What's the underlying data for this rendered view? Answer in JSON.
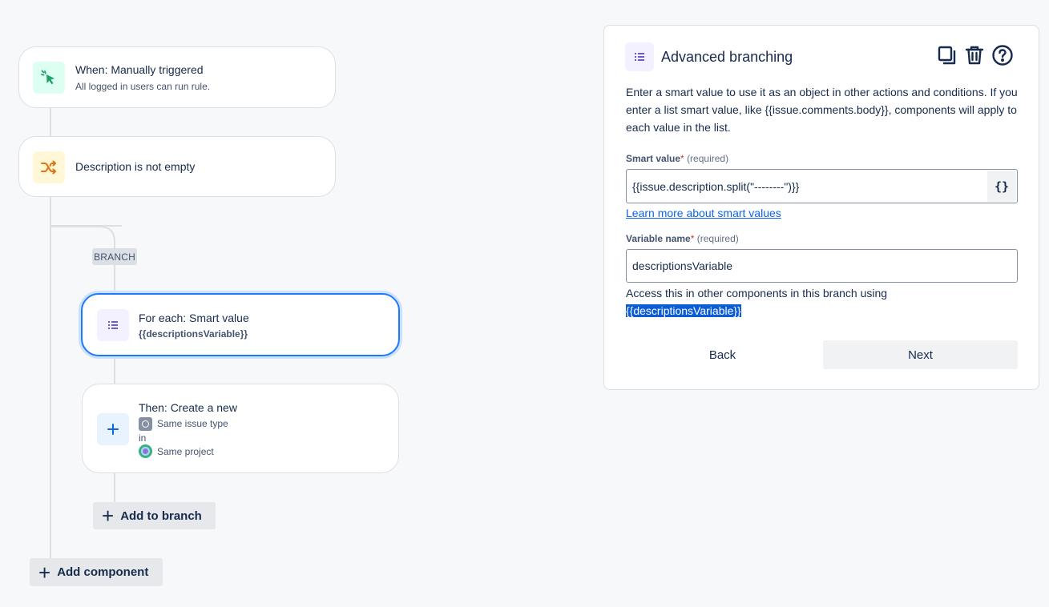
{
  "flow": {
    "trigger": {
      "title": "When: Manually triggered",
      "subtitle": "All logged in users can run rule."
    },
    "condition": {
      "title": "Description is not empty"
    },
    "branch_tag": "BRANCH",
    "foreach": {
      "title": "For each: Smart value",
      "subtitle": "{{descriptionsVariable}}"
    },
    "action": {
      "title": "Then: Create a new",
      "line1": "Same issue type",
      "line2": "in",
      "line3": "Same project"
    },
    "add_to_branch": "Add to branch",
    "add_component": "Add component"
  },
  "panel": {
    "title": "Advanced branching",
    "description": "Enter a smart value to use it as an object in other actions and conditions. If you enter a list smart value, like {{issue.comments.body}}, components will apply to each value in the list.",
    "smart_value_label": "Smart value",
    "required_star": "*",
    "required_text": "(required)",
    "smart_value": "{{issue.description.split(\"--------\")}}",
    "braces": "{}",
    "learn_more": "Learn more about smart values",
    "variable_label": "Variable name",
    "variable_value": "descriptionsVariable",
    "hint_text": "Access this in other components in this branch using",
    "hint_token": "{{descriptionsVariable}}",
    "back": "Back",
    "next": "Next"
  },
  "icons": {
    "trigger": "cursor-click-icon",
    "condition": "shuffle-icon",
    "foreach": "list-icon",
    "action": "plus-icon",
    "duplicate": "copy-icon",
    "delete": "trash-icon",
    "help": "help-icon"
  },
  "colors": {
    "accent": "#0c66e4",
    "selected_border": "#1d7afc",
    "trigger_bg": "#dcfff1",
    "trigger_icon": "#22a06b",
    "condition_bg": "#fff7d6",
    "condition_icon": "#e2740f",
    "list_bg": "#f3f0ff",
    "list_icon": "#6e5dc6",
    "action_bg": "#e9f2ff"
  }
}
